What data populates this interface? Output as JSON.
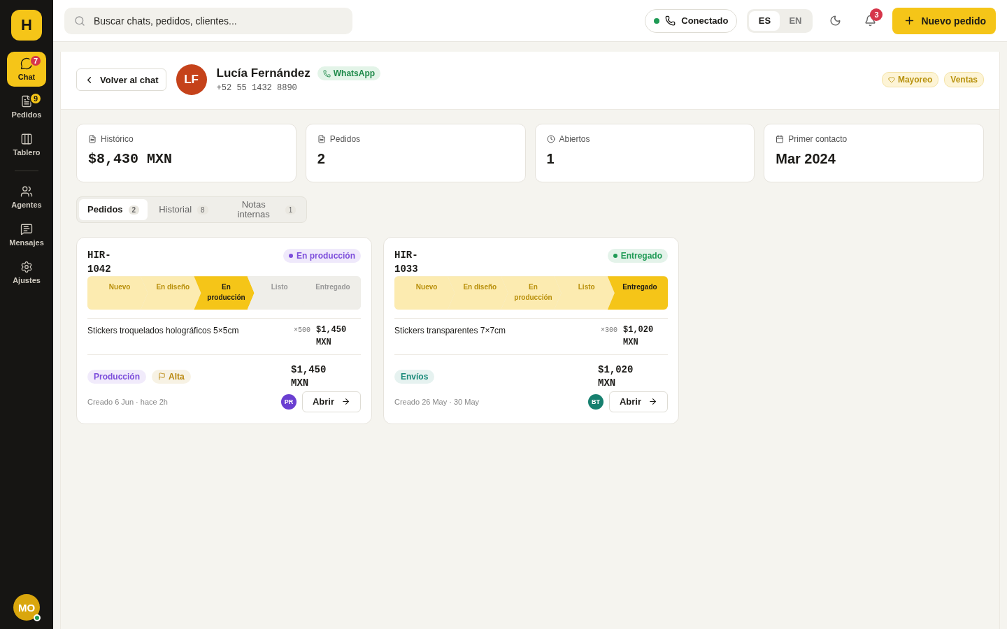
{
  "logo": "H",
  "sidebar": {
    "items": [
      {
        "label": "Chat",
        "badge": "7",
        "selected": true
      },
      {
        "label": "Pedidos",
        "badge": "9",
        "selected": false
      },
      {
        "label": "Tablero",
        "selected": false
      },
      {
        "label": "Agentes",
        "selected": false
      },
      {
        "label": "Mensajes",
        "selected": false
      },
      {
        "label": "Ajustes",
        "selected": false
      }
    ],
    "user": {
      "initials": "MO",
      "online": true
    }
  },
  "topbar": {
    "search": {
      "placeholder": "Buscar chats, pedidos, clientes..."
    },
    "connection": {
      "label": "Conectado",
      "on": true
    },
    "languages": [
      {
        "label": "ES",
        "selected": true
      },
      {
        "label": "EN",
        "selected": false
      }
    ],
    "notifications": "3",
    "new_order": "Nuevo pedido"
  },
  "customer": {
    "back": "Volver al chat",
    "initials": "LF",
    "name": "Lucía Fernández",
    "channel": "WhatsApp",
    "phone": "+52 55 1432 8890",
    "tags": [
      {
        "label": "Mayoreo",
        "icon": true
      },
      {
        "label": "Ventas",
        "icon": false
      }
    ]
  },
  "stats": [
    {
      "label": "Histórico",
      "value": "$8,430 MXN"
    },
    {
      "label": "Pedidos",
      "value": "2"
    },
    {
      "label": "Abiertos",
      "value": "1"
    },
    {
      "label": "Primer contacto",
      "value": "Mar 2024"
    }
  ],
  "tabs": [
    {
      "label": "Pedidos",
      "count": "2",
      "selected": true
    },
    {
      "label": "Historial",
      "count": "8",
      "selected": false
    },
    {
      "label": "Notas internas",
      "count": "1",
      "selected": false
    }
  ],
  "orders": [
    {
      "code": "HIR-1042",
      "status": "En producción",
      "color": "#7c4ddb",
      "stages": [
        {
          "label": "Nuevo",
          "kind": "done"
        },
        {
          "label": "En diseño",
          "kind": "done"
        },
        {
          "label": "En producción",
          "kind": "current"
        },
        {
          "label": "Listo",
          "kind": "pending"
        },
        {
          "label": "Entregado",
          "kind": "pending"
        }
      ],
      "item": {
        "name": "Stickers troquelados holográficos 5×5cm",
        "qty": "×500",
        "price": "$1,450 MXN"
      },
      "tags": [
        {
          "label": "Producción",
          "color": "#7c4ddb",
          "flag": false
        },
        {
          "label": "Alta",
          "color": "#b8860b",
          "flag": true
        }
      ],
      "total": "$1,450 MXN",
      "created": "Creado 6 Jun · hace 2h",
      "agent": {
        "initials": "PR",
        "color": "#6a3fd1"
      },
      "open": "Abrir"
    },
    {
      "code": "HIR-1033",
      "status": "Entregado",
      "color": "#1f9a55",
      "stages": [
        {
          "label": "Nuevo",
          "kind": "done"
        },
        {
          "label": "En diseño",
          "kind": "done"
        },
        {
          "label": "En producción",
          "kind": "done"
        },
        {
          "label": "Listo",
          "kind": "done"
        },
        {
          "label": "Entregado",
          "kind": "current"
        }
      ],
      "item": {
        "name": "Stickers transparentes 7×7cm",
        "qty": "×300",
        "price": "$1,020 MXN"
      },
      "tags": [
        {
          "label": "Envíos",
          "color": "#1b8a7a",
          "flag": false
        }
      ],
      "total": "$1,020 MXN",
      "created": "Creado 26 May · 30 May",
      "agent": {
        "initials": "BT",
        "color": "#17806f"
      },
      "open": "Abrir"
    }
  ]
}
